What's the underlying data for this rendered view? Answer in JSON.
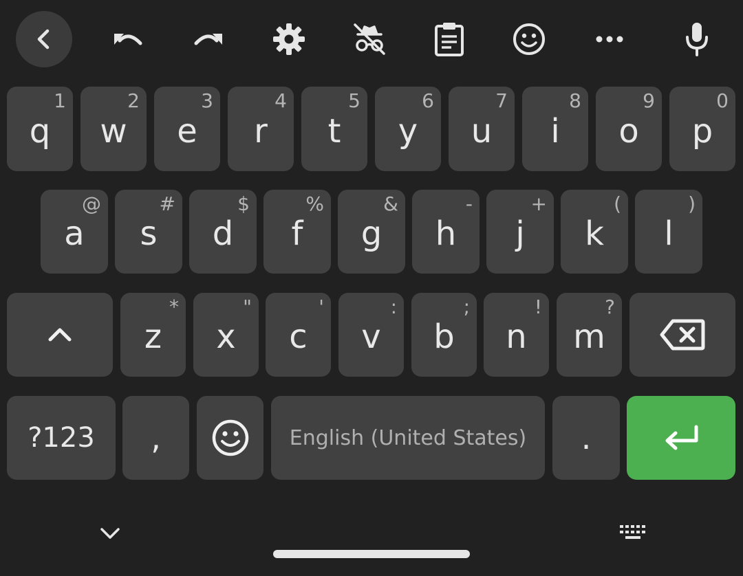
{
  "toolbar": {
    "icons": [
      "back-arrow-icon",
      "undo-icon",
      "redo-icon",
      "gear-icon",
      "incognito-off-icon",
      "clipboard-icon",
      "emoji-icon",
      "more-icon",
      "microphone-icon"
    ]
  },
  "rows": {
    "row1": [
      {
        "label": "q",
        "hint": "1"
      },
      {
        "label": "w",
        "hint": "2"
      },
      {
        "label": "e",
        "hint": "3"
      },
      {
        "label": "r",
        "hint": "4"
      },
      {
        "label": "t",
        "hint": "5"
      },
      {
        "label": "y",
        "hint": "6"
      },
      {
        "label": "u",
        "hint": "7"
      },
      {
        "label": "i",
        "hint": "8"
      },
      {
        "label": "o",
        "hint": "9"
      },
      {
        "label": "p",
        "hint": "0"
      }
    ],
    "row2": [
      {
        "label": "a",
        "hint": "@"
      },
      {
        "label": "s",
        "hint": "#"
      },
      {
        "label": "d",
        "hint": "$"
      },
      {
        "label": "f",
        "hint": "%"
      },
      {
        "label": "g",
        "hint": "&"
      },
      {
        "label": "h",
        "hint": "-"
      },
      {
        "label": "j",
        "hint": "+"
      },
      {
        "label": "k",
        "hint": "("
      },
      {
        "label": "l",
        "hint": ")"
      }
    ],
    "row3": [
      {
        "label": "z",
        "hint": "*"
      },
      {
        "label": "x",
        "hint": "\""
      },
      {
        "label": "c",
        "hint": "'"
      },
      {
        "label": "v",
        "hint": ":"
      },
      {
        "label": "b",
        "hint": ";"
      },
      {
        "label": "n",
        "hint": "!"
      },
      {
        "label": "m",
        "hint": "?"
      }
    ]
  },
  "bottom": {
    "symbols_label": "?123",
    "comma_label": ",",
    "space_label": "English (United States)",
    "period_label": "."
  },
  "colors": {
    "background": "#212121",
    "key": "#414141",
    "enter": "#4caf50"
  }
}
